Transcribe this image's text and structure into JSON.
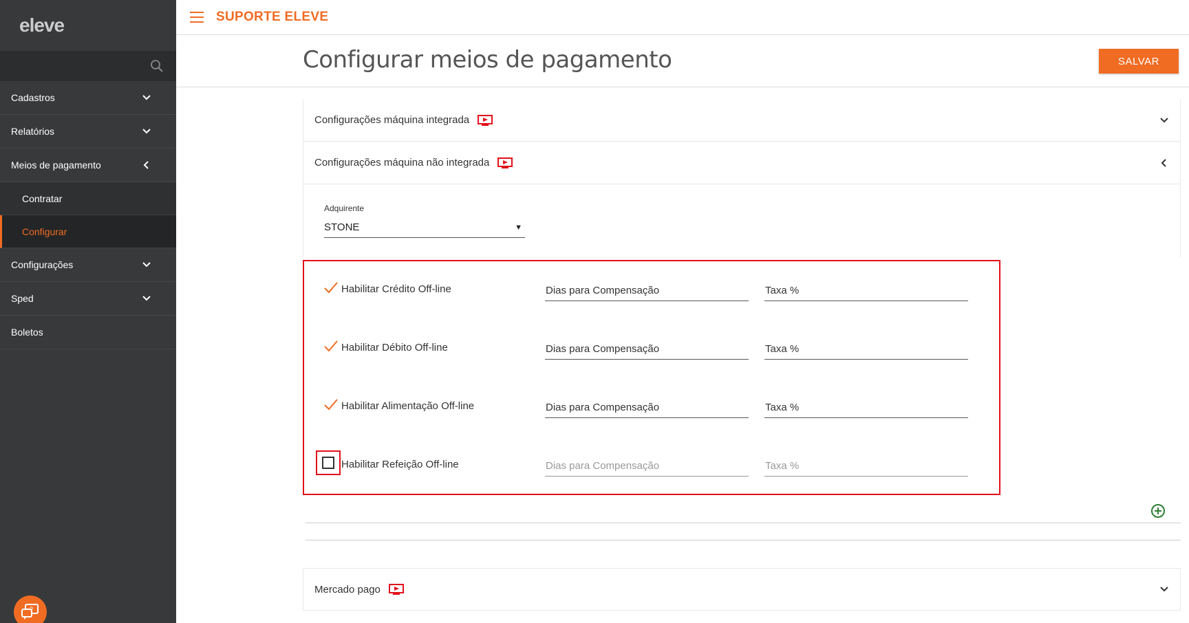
{
  "brand": {
    "logo_text": "eleve",
    "accent": "#f06c23",
    "highlight": "#e20f1a"
  },
  "topbar": {
    "title": "SUPORTE ELEVE"
  },
  "sidebar": {
    "items": [
      {
        "label": "Cadastros"
      },
      {
        "label": "Relatórios"
      },
      {
        "label": "Meios de pagamento"
      },
      {
        "label": "Contratar"
      },
      {
        "label": "Configurar"
      },
      {
        "label": "Configurações"
      },
      {
        "label": "Sped"
      },
      {
        "label": "Boletos"
      }
    ]
  },
  "page": {
    "title": "Configurar meios de pagamento",
    "save_label": "SALVAR"
  },
  "sections": {
    "integrated": "Configurações máquina integrada",
    "non_integrated": "Configurações máquina não integrada",
    "mercado_pago": "Mercado pago"
  },
  "acquirer": {
    "label": "Adquirente",
    "value": "STONE"
  },
  "offline_rows": [
    {
      "label": "Habilitar Crédito Off-line",
      "enabled": true,
      "days": "Dias para Compensação",
      "fee": "Taxa %"
    },
    {
      "label": "Habilitar Débito Off-line",
      "enabled": true,
      "days": "Dias para Compensação",
      "fee": "Taxa %"
    },
    {
      "label": "Habilitar Alimentação Off-line",
      "enabled": true,
      "days": "Dias para Compensação",
      "fee": "Taxa %"
    },
    {
      "label": "Habilitar Refeição Off-line",
      "enabled": false,
      "days": "Dias para Compensação",
      "fee": "Taxa %"
    }
  ]
}
